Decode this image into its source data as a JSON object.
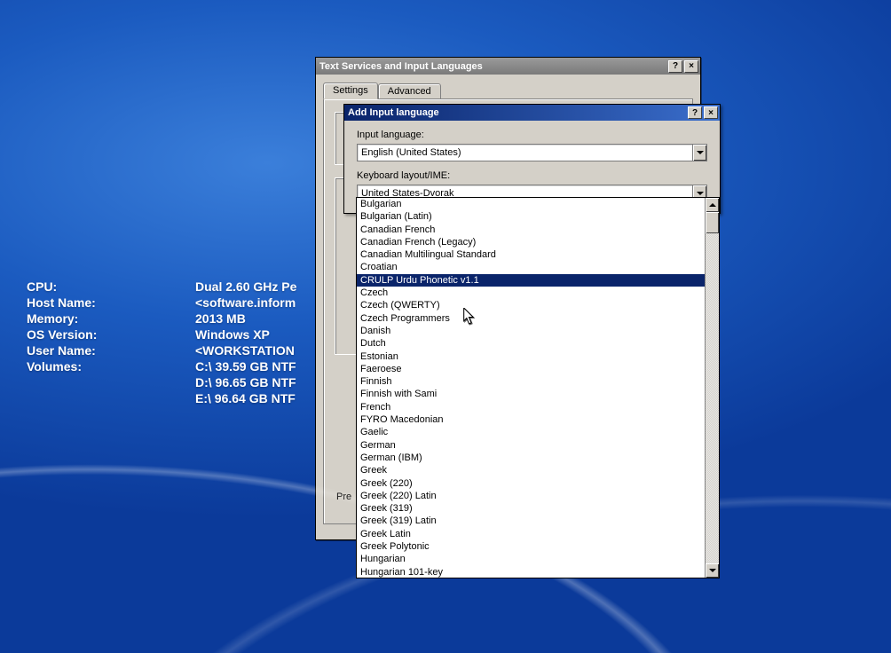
{
  "desktop": {
    "labels": {
      "cpu": "CPU:",
      "host": "Host Name:",
      "memory": "Memory:",
      "os": "OS Version:",
      "user": "User Name:",
      "volumes": "Volumes:"
    },
    "values": {
      "cpu": "Dual 2.60 GHz Pe",
      "host": "<software.inform",
      "memory": "2013 MB",
      "os": "Windows XP",
      "user": "<WORKSTATION",
      "vol_c": "C:\\ 39.59 GB NTF",
      "vol_d": "D:\\ 96.65 GB NTF",
      "vol_e": "E:\\ 96.64 GB NTF"
    }
  },
  "parentDialog": {
    "title": "Text Services and Input Languages",
    "tabs": {
      "settings": "Settings",
      "advanced": "Advanced"
    },
    "preferencesPrefix": "Pre"
  },
  "innerDialog": {
    "title": "Add Input language",
    "inputLanguageLabel": "Input language:",
    "inputLanguageValue": "English (United States)",
    "keyboardLabel": "Keyboard layout/IME:",
    "keyboardValue": "United States-Dvorak"
  },
  "dropdown": {
    "selectedIndex": 6,
    "items": [
      "Bulgarian",
      "Bulgarian (Latin)",
      "Canadian French",
      "Canadian French (Legacy)",
      "Canadian Multilingual Standard",
      "Croatian",
      "CRULP Urdu Phonetic v1.1",
      "Czech",
      "Czech (QWERTY)",
      "Czech Programmers",
      "Danish",
      "Dutch",
      "Estonian",
      "Faeroese",
      "Finnish",
      "Finnish with Sami",
      "French",
      "FYRO Macedonian",
      "Gaelic",
      "German",
      "German (IBM)",
      "Greek",
      "Greek (220)",
      "Greek (220) Latin",
      "Greek (319)",
      "Greek (319) Latin",
      "Greek Latin",
      "Greek Polytonic",
      "Hungarian",
      "Hungarian 101-key"
    ]
  },
  "buttons": {
    "help": "?",
    "close": "×"
  }
}
